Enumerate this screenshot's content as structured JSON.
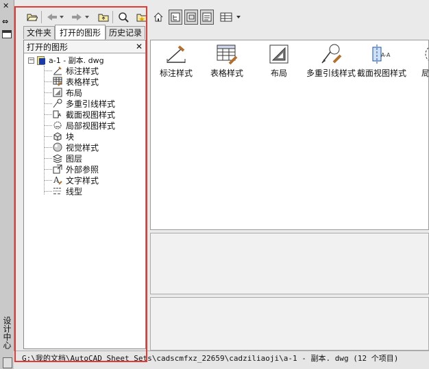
{
  "palette": {
    "title": "设计中心",
    "close_icon": "close-icon",
    "autohide_icon": "auto-hide-icon",
    "properties_icon": "properties-icon"
  },
  "toolbar": {
    "buttons": [
      {
        "name": "load-button",
        "icon": "folder-open-icon"
      },
      {
        "name": "back-button",
        "icon": "arrow-left-icon"
      },
      {
        "name": "forward-button",
        "icon": "arrow-right-icon"
      },
      {
        "name": "up-button",
        "icon": "folder-up-icon"
      },
      {
        "name": "search-button",
        "icon": "search-icon"
      },
      {
        "name": "favorites-button",
        "icon": "favorites-icon"
      },
      {
        "name": "home-button",
        "icon": "home-icon"
      },
      {
        "name": "tree-view-toggle",
        "icon": "tree-icon"
      },
      {
        "name": "preview-toggle",
        "icon": "preview-icon"
      },
      {
        "name": "description-toggle",
        "icon": "description-icon"
      },
      {
        "name": "views-button",
        "icon": "views-icon"
      }
    ]
  },
  "tabs": [
    {
      "label": "文件夹",
      "active": false
    },
    {
      "label": "打开的图形",
      "active": true
    },
    {
      "label": "历史记录",
      "active": false
    }
  ],
  "tree": {
    "header": "打开的图形",
    "root": {
      "label": "a-1 - 副本. dwg",
      "expanded": true
    },
    "items": [
      {
        "label": "标注样式",
        "icon": "dimstyle-icon"
      },
      {
        "label": "表格样式",
        "icon": "tablestyle-icon"
      },
      {
        "label": "布局",
        "icon": "layout-icon"
      },
      {
        "label": "多重引线样式",
        "icon": "mleaderstyle-icon"
      },
      {
        "label": "截面视图样式",
        "icon": "sectionviewstyle-icon"
      },
      {
        "label": "局部视图样式",
        "icon": "detailviewstyle-icon"
      },
      {
        "label": "块",
        "icon": "block-icon"
      },
      {
        "label": "视觉样式",
        "icon": "visualstyle-icon"
      },
      {
        "label": "图层",
        "icon": "layer-icon"
      },
      {
        "label": "外部参照",
        "icon": "xref-icon"
      },
      {
        "label": "文字样式",
        "icon": "textstyle-icon"
      },
      {
        "label": "线型",
        "icon": "linetype-icon"
      }
    ]
  },
  "content": {
    "items": [
      {
        "label": "标注样式",
        "icon": "dimstyle-icon"
      },
      {
        "label": "表格样式",
        "icon": "tablestyle-icon"
      },
      {
        "label": "布局",
        "icon": "layout-icon"
      },
      {
        "label": "多重引线样式",
        "icon": "mleaderstyle-icon"
      },
      {
        "label": "截面视图样式",
        "icon": "sectionviewstyle-icon"
      },
      {
        "label": "局部视",
        "icon": "detailviewstyle-icon"
      }
    ]
  },
  "status": {
    "path": "G:\\我的文档\\AutoCAD Sheet Sets\\cadscmfxz_22659\\cadziliaoji\\a-1 - 副本. dwg (12 个项目)"
  },
  "highlight_color": "#e53935"
}
